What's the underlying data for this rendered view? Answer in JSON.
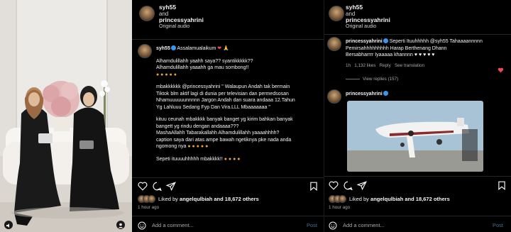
{
  "mid": {
    "user1": "syh55",
    "and": "and",
    "user2": "princessyahrini",
    "audio": "Original audio",
    "comment_user": "syh55",
    "comment_text": [
      "Assalamualaikum",
      "Alhamdulillahh yaahh saya?? syantikkkkk??",
      "Alhamdulillahh yaaahh ga mau sombong!!",
      "mbakkkkkk @princessyahrini \" Walaupun Andah tak bermain",
      "Tiktok blm aktif lagi di dunia per televisian dan permedsosan",
      "Nhamuuuuuunnnnn Jargon Andah dan suara andaaa 12.Tahun",
      "Yg Lahluuu Sedang Fyp Dan Vira.LLL Mbaaaaaaa \"",
      "kituu ceunah mbakkkk banyak banget yg kirim bahkan banyak",
      "bangett yg rindu dengan andaaaa???",
      "MashaAllahh Tabarakallahh Alhamdulillahh yaaaahhhh?",
      "caption saya dari atas ampe bawah ngetiknya pke nada anda",
      "ngomong nya",
      "Sepeti ituuuuhhhhh mbakkkk!!"
    ],
    "liked_by": "Liked by",
    "liked_user": "angelqulbiah",
    "and_others": "and 18,672 others",
    "time": "1 hour ago",
    "add_comment": "Add a comment...",
    "post": "Post"
  },
  "right": {
    "user1": "syh55",
    "and": "and",
    "user2": "princessyahrini",
    "audio": "Original audio",
    "reply_user": "princessyahrini",
    "reply_text": [
      "Seperti Ituuhhhhh @syh55 Tahaaaannnnn",
      "Pemirsahhhhhhhhh Harap Berthenang Dhann",
      "Bersabharrrr Iyaaaaa khannnn"
    ],
    "reply_meta": [
      "1h",
      "1,132 likes",
      "Reply",
      "See translation"
    ],
    "view_replies": "View replies (157)",
    "comment2_user": "princessyahrini",
    "liked_by": "Liked by",
    "liked_user": "angelqulbiah",
    "and_others": "and 18,672 others",
    "time": "1 hour ago",
    "add_comment": "Add a comment...",
    "post": "Post"
  }
}
